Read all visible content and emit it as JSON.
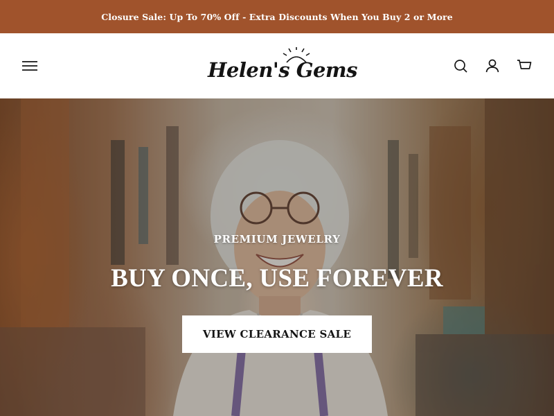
{
  "announcement": {
    "text": "Closure Sale: Up To 70% Off - Extra Discounts When You Buy 2 or More"
  },
  "header": {
    "logo_text": "Helen's Gems",
    "icons": [
      "menu-icon",
      "search-icon",
      "account-icon",
      "cart-icon"
    ]
  },
  "hero": {
    "eyebrow": "PREMIUM JEWELRY",
    "title": "BUY ONCE, USE FOREVER",
    "cta_label": "VIEW CLEARANCE SALE"
  },
  "colors": {
    "announcement_bg": "#a0532c",
    "announcement_text": "#ffffff",
    "header_bg": "#ffffff",
    "icon_color": "#141414",
    "cta_bg": "#ffffff",
    "cta_text": "#141414"
  }
}
